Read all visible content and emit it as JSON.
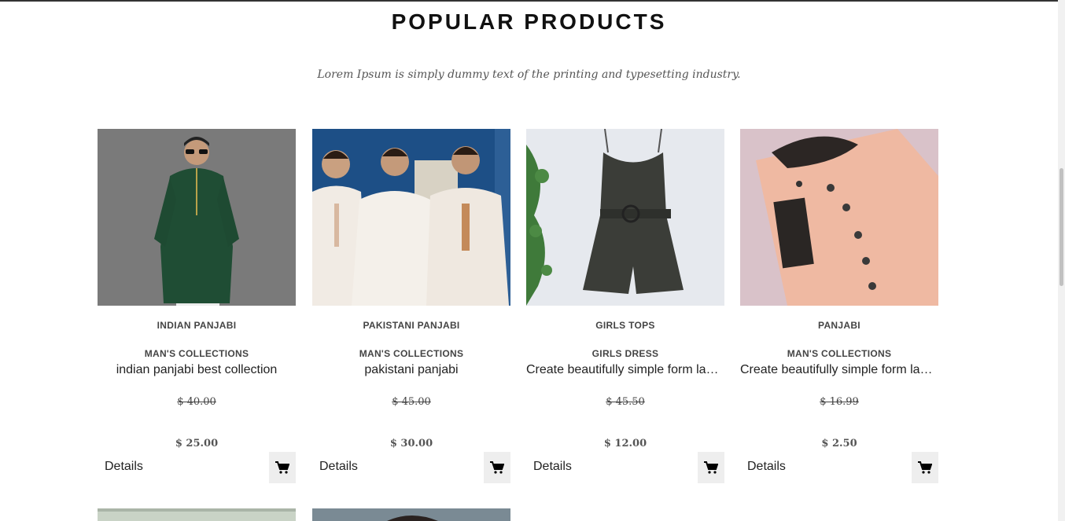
{
  "section": {
    "title": "POPULAR PRODUCTS",
    "subtitle": "Lorem Ipsum is simply dummy text of the printing and typesetting industry."
  },
  "products": [
    {
      "name": "INDIAN PANJABI",
      "category": "MAN'S COLLECTIONS",
      "description": "indian panjabi best collection",
      "old_price": "$ 40.00",
      "price": "$ 25.00",
      "details_label": "Details",
      "image": "green-panjabi-man-photo"
    },
    {
      "name": "PAKISTANI PANJABI",
      "category": "MAN'S COLLECTIONS",
      "description": "pakistani panjabi",
      "old_price": "$ 45.00",
      "price": "$ 30.00",
      "details_label": "Details",
      "image": "three-men-white-panjabi-photo"
    },
    {
      "name": "GIRLS TOPS",
      "category": "GIRLS DRESS",
      "description": "Create beautifully simple form labels",
      "old_price": "$ 45.50",
      "price": "$ 12.00",
      "details_label": "Details",
      "image": "dark-romper-photo"
    },
    {
      "name": "PANJABI",
      "category": "MAN'S COLLECTIONS",
      "description": "Create beautifully simple form labels",
      "old_price": "$ 16.99",
      "price": "$ 2.50",
      "details_label": "Details",
      "image": "peach-panjabi-folded-photo"
    }
  ],
  "icons": {
    "cart": "shopping-cart-icon"
  }
}
